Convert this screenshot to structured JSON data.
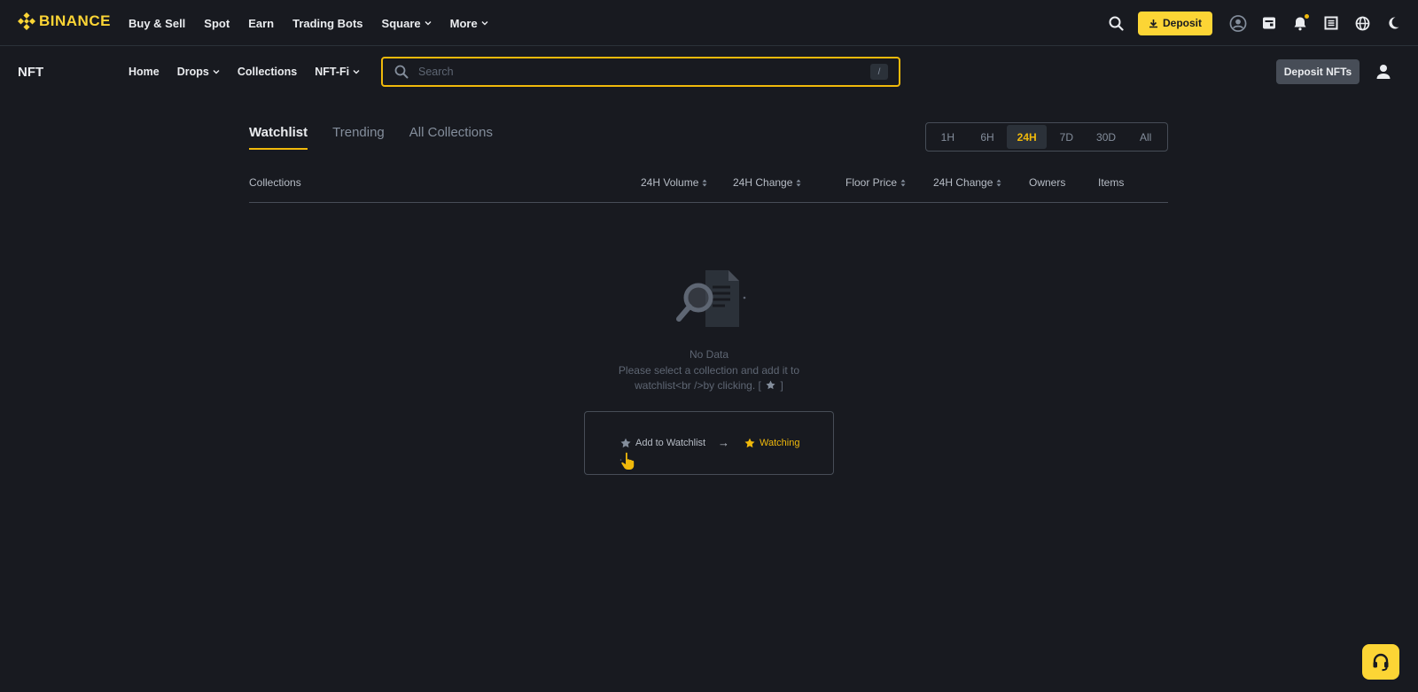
{
  "brand": {
    "name": "BINANCE",
    "accent": "#fcd535"
  },
  "topnav": {
    "items": [
      {
        "label": "Buy & Sell",
        "has_dropdown": false
      },
      {
        "label": "Spot",
        "has_dropdown": false
      },
      {
        "label": "Earn",
        "has_dropdown": false
      },
      {
        "label": "Trading Bots",
        "has_dropdown": false
      },
      {
        "label": "Square",
        "has_dropdown": true
      },
      {
        "label": "More",
        "has_dropdown": true
      }
    ],
    "deposit_label": "Deposit",
    "right_icons": [
      "search-icon",
      "download-icon",
      "account-icon",
      "wallet-icon",
      "bell-icon",
      "transfer-icon",
      "globe-icon",
      "moon-icon"
    ]
  },
  "subnav": {
    "title": "NFT",
    "items": [
      {
        "label": "Home",
        "has_dropdown": false
      },
      {
        "label": "Drops",
        "has_dropdown": true
      },
      {
        "label": "Collections",
        "has_dropdown": false
      },
      {
        "label": "NFT-Fi",
        "has_dropdown": true
      }
    ],
    "search_placeholder": "Search",
    "search_shortcut": "/",
    "deposit_nfts_label": "Deposit NFTs"
  },
  "tabs": [
    {
      "label": "Watchlist",
      "active": true
    },
    {
      "label": "Trending",
      "active": false
    },
    {
      "label": "All Collections",
      "active": false
    }
  ],
  "time_filters": [
    {
      "label": "1H",
      "active": false
    },
    {
      "label": "6H",
      "active": false
    },
    {
      "label": "24H",
      "active": true
    },
    {
      "label": "7D",
      "active": false
    },
    {
      "label": "30D",
      "active": false
    },
    {
      "label": "All",
      "active": false
    }
  ],
  "table": {
    "columns": [
      {
        "label": "Collections",
        "sortable": false
      },
      {
        "label": "24H Volume",
        "sortable": true
      },
      {
        "label": "24H Change",
        "sortable": true
      },
      {
        "label": "Floor Price",
        "sortable": true
      },
      {
        "label": "24H Change",
        "sortable": true
      },
      {
        "label": "Owners",
        "sortable": false
      },
      {
        "label": "Items",
        "sortable": false
      }
    ]
  },
  "empty_state": {
    "title": "No Data",
    "line1": "Please select a collection and add it to",
    "line2_prefix": "watchlist<br />by clicking.  [",
    "line2_suffix": "]",
    "hint_add_label": "Add to Watchlist",
    "hint_arrow": "→",
    "hint_watching_label": "Watching"
  }
}
